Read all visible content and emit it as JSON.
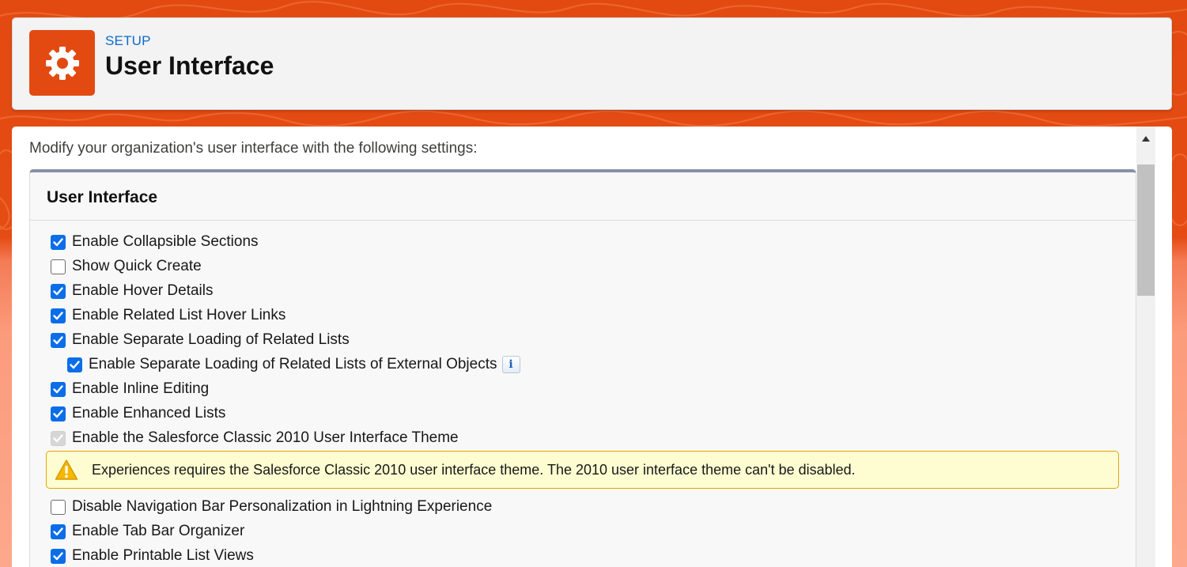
{
  "header": {
    "eyebrow": "SETUP",
    "title": "User Interface",
    "icon": "gear-icon"
  },
  "main": {
    "intro": "Modify your organization's user interface with the following settings:",
    "section": {
      "title": "User Interface",
      "options": [
        {
          "label": "Enable Collapsible Sections",
          "checked": true
        },
        {
          "label": "Show Quick Create",
          "checked": false
        },
        {
          "label": "Enable Hover Details",
          "checked": true
        },
        {
          "label": "Enable Related List Hover Links",
          "checked": true
        },
        {
          "label": "Enable Separate Loading of Related Lists",
          "checked": true
        },
        {
          "label": "Enable Separate Loading of Related Lists of External Objects",
          "checked": true,
          "info_icon": "info-icon"
        },
        {
          "label": "Enable Inline Editing",
          "checked": true
        },
        {
          "label": "Enable Enhanced Lists",
          "checked": true
        },
        {
          "label": "Enable the Salesforce Classic 2010 User Interface Theme",
          "checked": true,
          "disabled": true
        },
        {
          "label": "Disable Navigation Bar Personalization in Lightning Experience",
          "checked": false
        },
        {
          "label": "Enable Tab Bar Organizer",
          "checked": true
        },
        {
          "label": "Enable Printable List Views",
          "checked": true
        }
      ],
      "warning": {
        "icon": "warning-icon",
        "text": "Experiences requires the Salesforce Classic 2010 user interface theme. The 2010 user interface theme can't be disabled."
      }
    }
  },
  "colors": {
    "brand": "#e34a12",
    "checkbox": "#0b6ee8",
    "link": "#0b6bc9",
    "warning_bg": "#fefdd1",
    "warning_border": "#e0a800"
  }
}
